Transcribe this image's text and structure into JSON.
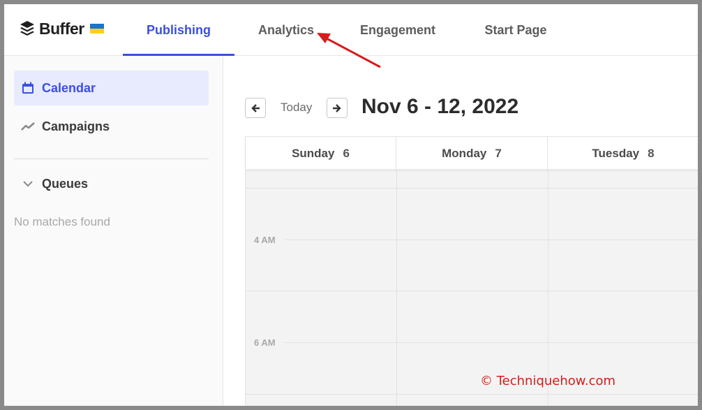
{
  "brand": {
    "name": "Buffer",
    "flag_colors": [
      "#1e6fd9",
      "#f7d21c"
    ]
  },
  "nav": {
    "tabs": [
      {
        "label": "Publishing",
        "active": true
      },
      {
        "label": "Analytics",
        "active": false
      },
      {
        "label": "Engagement",
        "active": false
      },
      {
        "label": "Start Page",
        "active": false
      }
    ]
  },
  "sidebar": {
    "items": [
      {
        "label": "Calendar",
        "icon": "calendar-icon",
        "active": true
      },
      {
        "label": "Campaigns",
        "icon": "trend-icon",
        "active": false
      }
    ],
    "queues_label": "Queues",
    "empty_text": "No matches found"
  },
  "calendar": {
    "today_label": "Today",
    "range_title": "Nov 6 - 12, 2022",
    "days": [
      {
        "name": "Sunday",
        "num": "6"
      },
      {
        "name": "Monday",
        "num": "7"
      },
      {
        "name": "Tuesday",
        "num": "8"
      }
    ],
    "times": [
      "4 AM",
      "6 AM"
    ]
  },
  "watermark": "© Techniquehow.com",
  "colors": {
    "accent": "#3b4fe0",
    "annotation": "#d81b1b"
  }
}
